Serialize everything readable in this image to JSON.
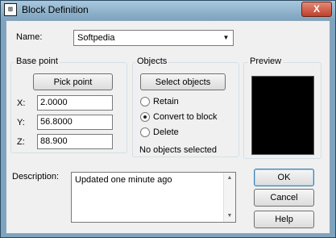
{
  "window": {
    "title": "Block Definition",
    "app_icon": "block-definition-icon",
    "close_label": "X"
  },
  "name": {
    "label": "Name:",
    "value": "Softpedia"
  },
  "base_point": {
    "title": "Base point",
    "pick_button": "Pick point",
    "x_label": "X:",
    "x_value": "2.0000",
    "y_label": "Y:",
    "y_value": "56.8000",
    "z_label": "Z:",
    "z_value": "88.900"
  },
  "objects": {
    "title": "Objects",
    "select_button": "Select objects",
    "options": [
      "Retain",
      "Convert to block",
      "Delete"
    ],
    "selected_option": "Convert to block",
    "status": "No objects selected"
  },
  "preview": {
    "title": "Preview"
  },
  "description": {
    "label": "Description:",
    "value": "Updated one minute ago"
  },
  "buttons": {
    "ok": "OK",
    "cancel": "Cancel",
    "help": "Help"
  }
}
